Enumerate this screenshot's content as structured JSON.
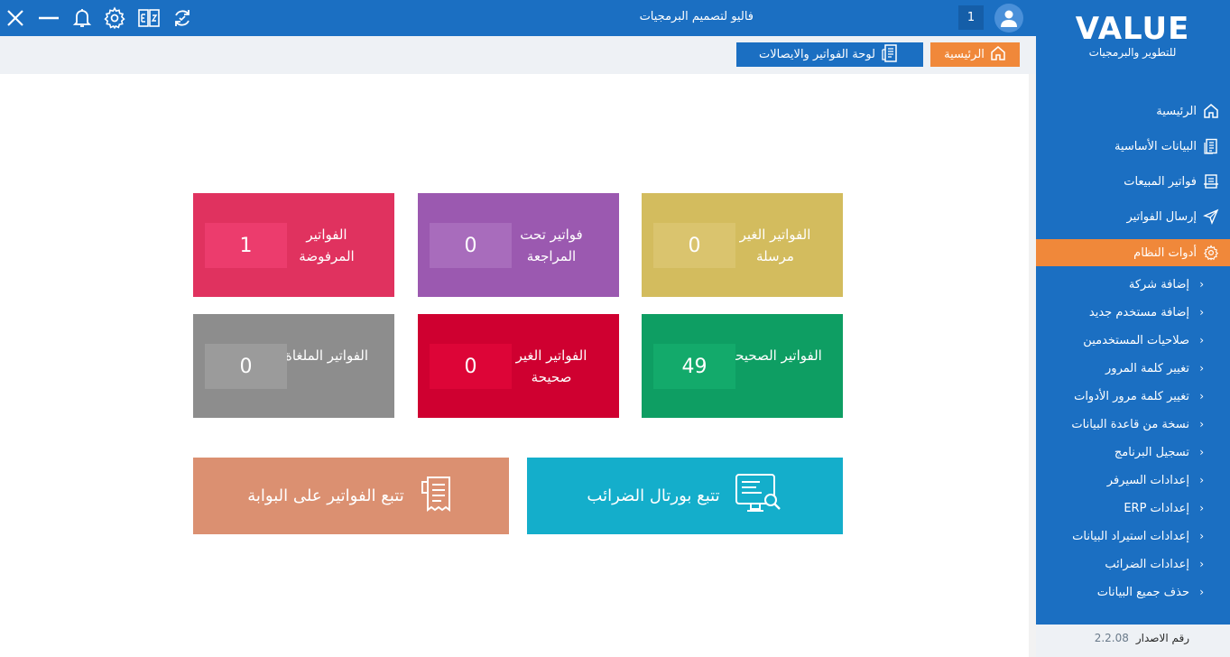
{
  "topbar": {
    "company_name": "فاليو لتصميم البرمجيات",
    "user_number": "1"
  },
  "tabs": {
    "home": "الرئيسية",
    "dashboard": "لوحة الفواتير والايصالات"
  },
  "cards": {
    "not_sent": {
      "title": "الفواتير الغير مرسلة",
      "value": "0",
      "color": "#d3bc5e",
      "box": "#dac46e"
    },
    "under_review": {
      "title": "فواتير تحت المراجعة",
      "value": "0",
      "color": "#9b59b0",
      "box": "#a86cbc"
    },
    "rejected": {
      "title": "الفواتير المرفوضة",
      "value": "1",
      "color": "#e0325f",
      "box": "#ec3c6d"
    },
    "valid": {
      "title": "الفواتير الصحيحة",
      "value": "49",
      "color": "#0e9e63",
      "box": "#13aa6b"
    },
    "invalid": {
      "title": "الفواتير الغير صحيحة",
      "value": "0",
      "color": "#cf0030",
      "box": "#dd0537"
    },
    "cancelled": {
      "title": "الفواتير الملغاة",
      "value": "0",
      "color": "#8d8d8d",
      "box": "#9b9b9b"
    }
  },
  "actions": {
    "tax_portal": "تتبع بورتال الضرائب",
    "gateway": "تتبع الفواتير على البوابة"
  },
  "sidebar": {
    "logo": "VALUE",
    "logo_sub": "للتطوير والبرمجيات",
    "items": [
      {
        "label": "الرئيسية",
        "icon": "home-icon"
      },
      {
        "label": "البيانات الأساسية",
        "icon": "document-icon"
      },
      {
        "label": "فواتير المبيعات",
        "icon": "invoice-icon"
      },
      {
        "label": "إرسال الفواتير",
        "icon": "send-icon"
      },
      {
        "label": "أدوات النظام",
        "icon": "gear-icon"
      }
    ],
    "sub_items": [
      "إضافة شركة",
      "إضافة مستخدم جديد",
      "صلاحيات المستخدمين",
      "تغيير كلمة المرور",
      "تغيير كلمة مرور الأدوات",
      "نسخة من قاعدة البيانات",
      "تسجيل البرنامج",
      "إعدادات السيرفر",
      "إعدادات ERP",
      "إعدادات استيراد البيانات",
      "إعدادات الضرائب",
      "حذف جميع البيانات"
    ]
  },
  "version": {
    "label": "رقم الاصدار",
    "number": "2.2.08"
  },
  "colors": {
    "primary": "#1b6fc2",
    "accent": "#f0883a",
    "tax_portal": "#14aecb",
    "gateway": "#db9071"
  }
}
